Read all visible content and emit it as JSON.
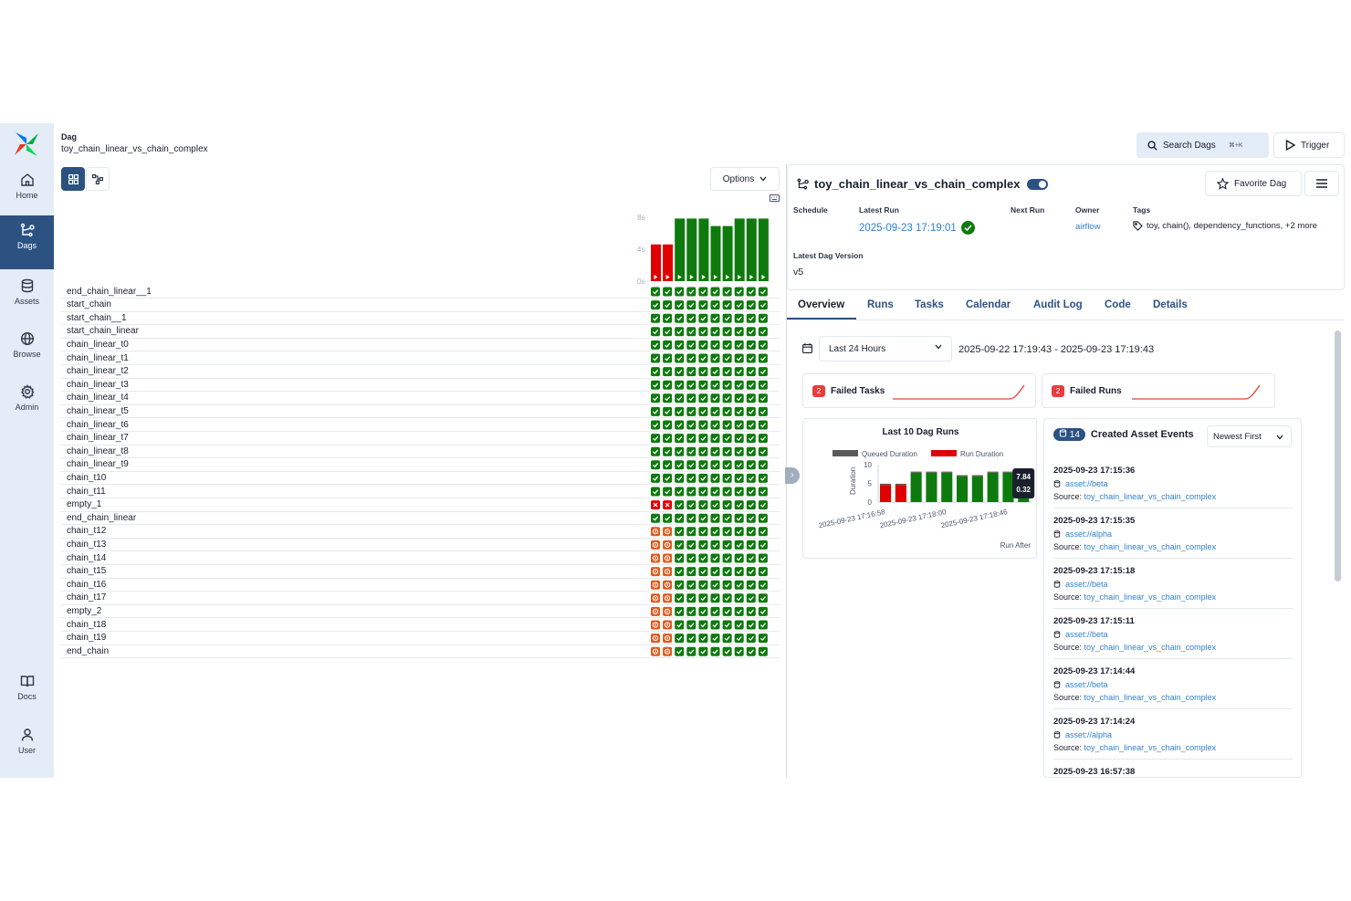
{
  "sidebar": {
    "items": [
      {
        "label": "Home",
        "icon": "home-icon"
      },
      {
        "label": "Dags",
        "icon": "dags-icon"
      },
      {
        "label": "Assets",
        "icon": "database-icon"
      },
      {
        "label": "Browse",
        "icon": "globe-icon"
      },
      {
        "label": "Admin",
        "icon": "gear-icon"
      },
      {
        "label": "Docs",
        "icon": "book-icon"
      },
      {
        "label": "User",
        "icon": "user-icon"
      }
    ]
  },
  "breadcrumb": {
    "label": "Dag",
    "value": "toy_chain_linear_vs_chain_complex"
  },
  "header": {
    "search_label": "Search Dags",
    "search_shortcut": "⌘+K",
    "trigger_label": "Trigger"
  },
  "grid": {
    "options_label": "Options",
    "duration_ticks": [
      "8s",
      "4s",
      "0s"
    ],
    "run_durations": [
      4.6,
      4.6,
      7.84,
      7.84,
      7.84,
      6.9,
      6.9,
      7.84,
      7.84,
      7.84
    ],
    "run_states": [
      "failed",
      "failed",
      "success",
      "success",
      "success",
      "success",
      "success",
      "success",
      "success",
      "success"
    ],
    "tasks": [
      {
        "name": "end_chain_linear__1",
        "states": "SSSSSSSSSS"
      },
      {
        "name": "start_chain",
        "states": "SSSSSSSSSS"
      },
      {
        "name": "start_chain__1",
        "states": "SSSSSSSSSS"
      },
      {
        "name": "start_chain_linear",
        "states": "SSSSSSSSSS"
      },
      {
        "name": "chain_linear_t0",
        "states": "SSSSSSSSSS"
      },
      {
        "name": "chain_linear_t1",
        "states": "SSSSSSSSSS"
      },
      {
        "name": "chain_linear_t2",
        "states": "SSSSSSSSSS"
      },
      {
        "name": "chain_linear_t3",
        "states": "SSSSSSSSSS"
      },
      {
        "name": "chain_linear_t4",
        "states": "SSSSSSSSSS"
      },
      {
        "name": "chain_linear_t5",
        "states": "SSSSSSSSSS"
      },
      {
        "name": "chain_linear_t6",
        "states": "SSSSSSSSSS"
      },
      {
        "name": "chain_linear_t7",
        "states": "SSSSSSSSSS"
      },
      {
        "name": "chain_linear_t8",
        "states": "SSSSSSSSSS"
      },
      {
        "name": "chain_linear_t9",
        "states": "SSSSSSSSSS"
      },
      {
        "name": "chain_t10",
        "states": "SSSSSSSSSS"
      },
      {
        "name": "chain_t11",
        "states": "SSSSSSSSSS"
      },
      {
        "name": "empty_1",
        "states": "FFSSSSSSSS"
      },
      {
        "name": "end_chain_linear",
        "states": "SSSSSSSSSS"
      },
      {
        "name": "chain_t12",
        "states": "UUSSSSSSSS"
      },
      {
        "name": "chain_t13",
        "states": "UUSSSSSSSS"
      },
      {
        "name": "chain_t14",
        "states": "UUSSSSSSSS"
      },
      {
        "name": "chain_t15",
        "states": "UUSSSSSSSS"
      },
      {
        "name": "chain_t16",
        "states": "UUSSSSSSSS"
      },
      {
        "name": "chain_t17",
        "states": "UUSSSSSSSS"
      },
      {
        "name": "empty_2",
        "states": "UUSSSSSSSS"
      },
      {
        "name": "chain_t18",
        "states": "UUSSSSSSSS"
      },
      {
        "name": "chain_t19",
        "states": "UUSSSSSSSS"
      },
      {
        "name": "end_chain",
        "states": "UUSSSSSSSS"
      }
    ]
  },
  "dag": {
    "title": "toy_chain_linear_vs_chain_complex",
    "favorite_label": "Favorite Dag",
    "schedule_label": "Schedule",
    "latest_run_label": "Latest Run",
    "latest_run_value": "2025-09-23 17:19:01",
    "next_run_label": "Next Run",
    "owner_label": "Owner",
    "owner_value": "airflow",
    "tags_label": "Tags",
    "tags_value": "toy, chain(), dependency_functions, +2 more",
    "version_label": "Latest Dag Version",
    "version_value": "v5"
  },
  "tabs": [
    "Overview",
    "Runs",
    "Tasks",
    "Calendar",
    "Audit Log",
    "Code",
    "Details"
  ],
  "overview": {
    "range_select": "Last 24 Hours",
    "date_range": "2025-09-22 17:19:43 - 2025-09-23 17:19:43",
    "failed_tasks": {
      "count": "2",
      "label": "Failed Tasks"
    },
    "failed_runs": {
      "count": "2",
      "label": "Failed Runs"
    }
  },
  "chart_data": {
    "type": "bar",
    "title": "Last 10 Dag Runs",
    "legend": [
      "Queued Duration",
      "Run Duration"
    ],
    "ylabel": "Duration",
    "xlabel": "Run After",
    "ylim": [
      0,
      10
    ],
    "yticks": [
      "10",
      "5",
      "0"
    ],
    "xticks": [
      "2025-09-23 17:16:58",
      "2025-09-23 17:18:00",
      "2025-09-23 17:18:46"
    ],
    "series": [
      {
        "name": "Queued Duration",
        "values": [
          0.3,
          0.3,
          0.3,
          0.3,
          0.3,
          0.3,
          0.3,
          0.3,
          0.3,
          0.32
        ]
      },
      {
        "name": "Run Duration",
        "values": [
          4.6,
          4.6,
          7.84,
          7.84,
          7.84,
          6.9,
          6.9,
          7.84,
          7.84,
          7.84
        ]
      }
    ],
    "colors": [
      "#e00000",
      "#e00000",
      "#0e7a0e",
      "#0e7a0e",
      "#0e7a0e",
      "#0e7a0e",
      "#0e7a0e",
      "#0e7a0e",
      "#0e7a0e",
      "#0e7a0e"
    ],
    "tooltip": [
      "7.84",
      "0.32"
    ]
  },
  "events": {
    "count": "14",
    "title": "Created Asset Events",
    "sort": "Newest First",
    "source_label": "Source:",
    "items": [
      {
        "ts": "2025-09-23 17:15:36",
        "uri": "asset://beta",
        "source": "toy_chain_linear_vs_chain_complex"
      },
      {
        "ts": "2025-09-23 17:15:35",
        "uri": "asset://alpha",
        "source": "toy_chain_linear_vs_chain_complex"
      },
      {
        "ts": "2025-09-23 17:15:18",
        "uri": "asset://beta",
        "source": "toy_chain_linear_vs_chain_complex"
      },
      {
        "ts": "2025-09-23 17:15:11",
        "uri": "asset://beta",
        "source": "toy_chain_linear_vs_chain_complex"
      },
      {
        "ts": "2025-09-23 17:14:44",
        "uri": "asset://beta",
        "source": "toy_chain_linear_vs_chain_complex"
      },
      {
        "ts": "2025-09-23 17:14:24",
        "uri": "asset://alpha",
        "source": "toy_chain_linear_vs_chain_complex"
      },
      {
        "ts": "2025-09-23 16:57:38",
        "uri": "",
        "source": ""
      }
    ]
  },
  "colors": {
    "success": "#0e7a0e",
    "failed": "#e00000",
    "upstream_failed": "#e05a1c",
    "accent": "#2c5282",
    "link": "#3182ce"
  }
}
